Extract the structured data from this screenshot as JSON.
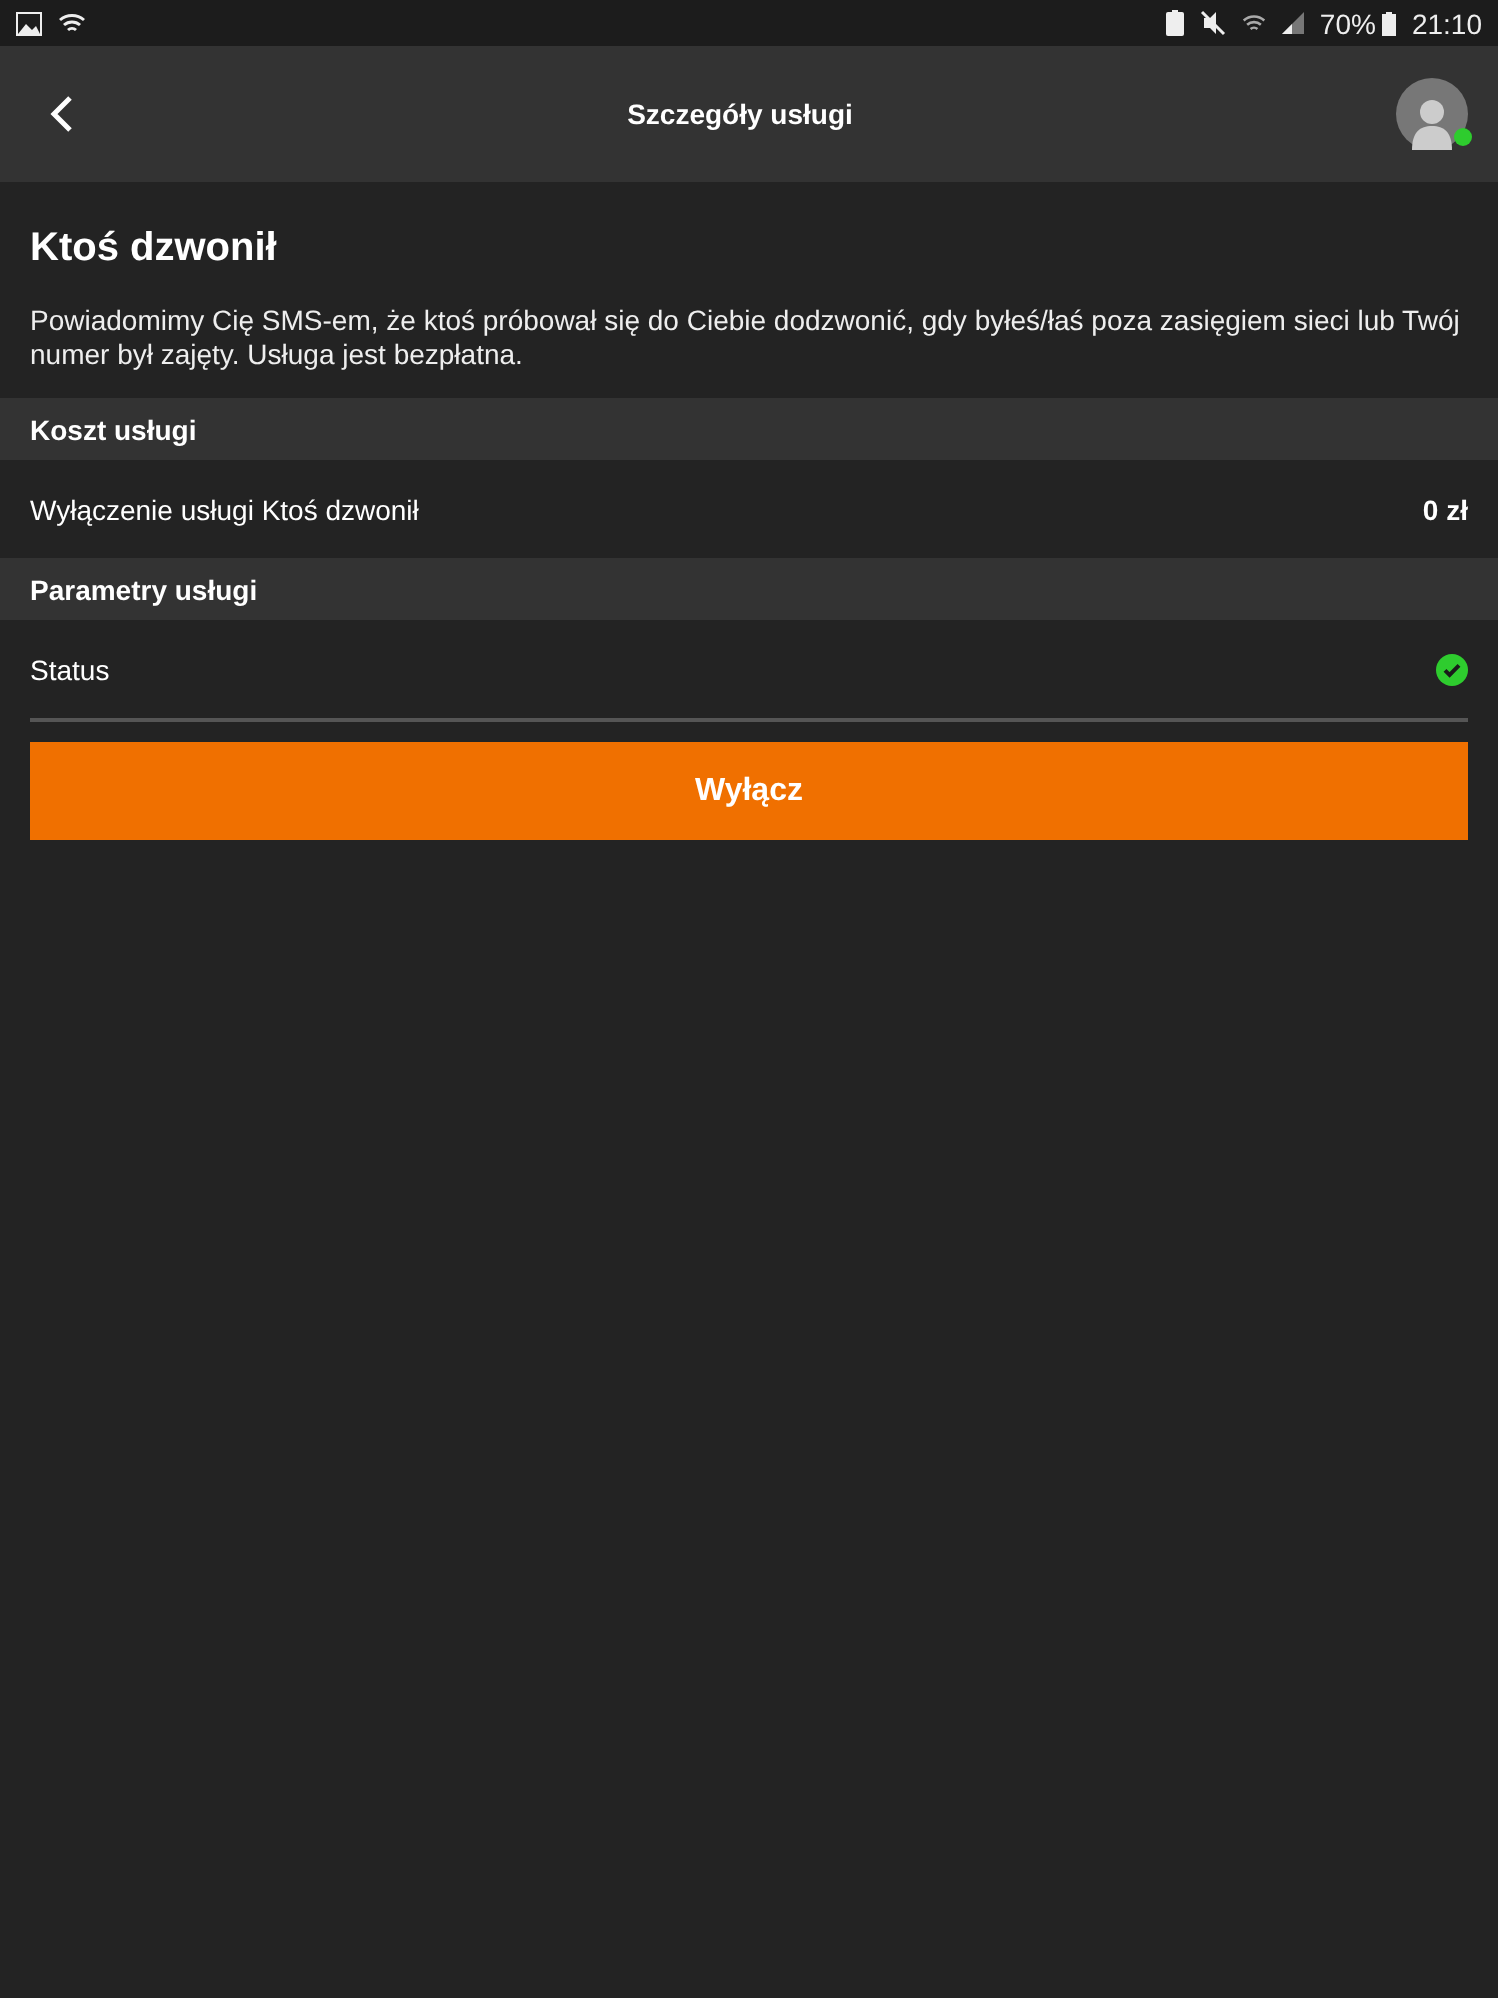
{
  "status_bar": {
    "battery": "70%",
    "time": "21:10"
  },
  "header": {
    "title": "Szczegóły usługi",
    "avatar": {
      "online": true
    }
  },
  "service": {
    "title": "Ktoś dzwonił",
    "description": "Powiadomimy Cię SMS-em, że ktoś próbował się do Ciebie dodzwonić, gdy byłeś/łaś poza zasięgiem sieci lub Twój numer był zajęty. Usługa jest bezpłatna."
  },
  "sections": [
    {
      "heading": "Koszt usługi",
      "rows": [
        {
          "kind": "price",
          "label": "Wyłączenie usługi Ktoś dzwonił",
          "value": "0 zł"
        }
      ]
    },
    {
      "heading": "Parametry usługi",
      "rows": [
        {
          "kind": "status",
          "label": "Status",
          "active": true
        }
      ]
    }
  ],
  "button": {
    "label": "Wyłącz"
  }
}
